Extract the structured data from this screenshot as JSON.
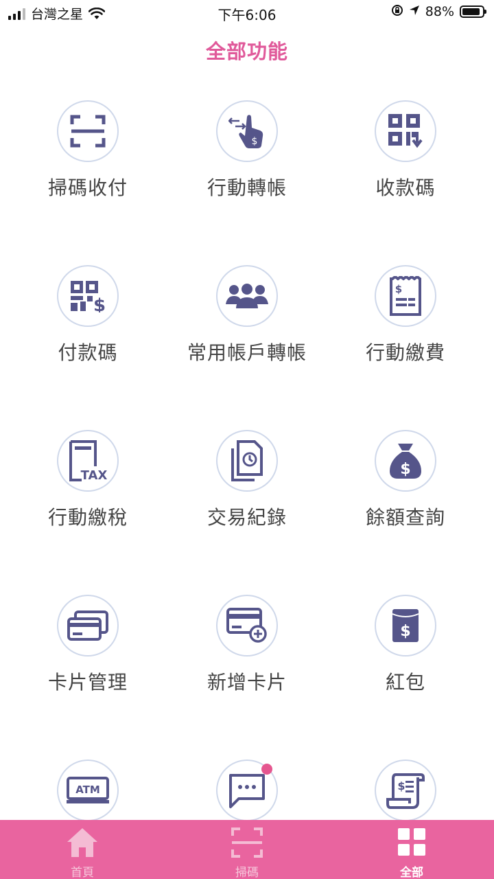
{
  "status_bar": {
    "carrier": "台灣之星",
    "time": "下午6:06",
    "battery": "88%",
    "battery_level": 0.88
  },
  "header": {
    "title": "全部功能"
  },
  "functions": [
    {
      "label": "掃碼收付",
      "icon": "scan-frame-icon"
    },
    {
      "label": "行動轉帳",
      "icon": "hand-transfer-icon"
    },
    {
      "label": "收款碼",
      "icon": "qr-receive-icon"
    },
    {
      "label": "付款碼",
      "icon": "qr-pay-icon"
    },
    {
      "label": "常用帳戶轉帳",
      "icon": "group-people-icon"
    },
    {
      "label": "行動繳費",
      "icon": "receipt-icon"
    },
    {
      "label": "行動繳稅",
      "icon": "tax-document-icon",
      "icon_text": "TAX"
    },
    {
      "label": "交易紀錄",
      "icon": "transaction-history-icon"
    },
    {
      "label": "餘額查詢",
      "icon": "money-bag-icon"
    },
    {
      "label": "卡片管理",
      "icon": "cards-icon"
    },
    {
      "label": "新增卡片",
      "icon": "add-card-icon"
    },
    {
      "label": "紅包",
      "icon": "red-envelope-icon"
    },
    {
      "label": "",
      "icon": "atm-icon",
      "icon_text": "ATM"
    },
    {
      "label": "",
      "icon": "message-icon",
      "notification": true
    },
    {
      "label": "",
      "icon": "bill-scroll-icon"
    }
  ],
  "tab_bar": {
    "tabs": [
      {
        "label": "首頁",
        "icon": "home-icon"
      },
      {
        "label": "掃碼",
        "icon": "scan-icon"
      },
      {
        "label": "全部",
        "icon": "grid-icon",
        "active": true
      }
    ]
  },
  "colors": {
    "accent": "#e0599a",
    "icon": "#5a5a8c",
    "tab_bar": "#e9649f",
    "circle_border": "#cfd8ea"
  }
}
